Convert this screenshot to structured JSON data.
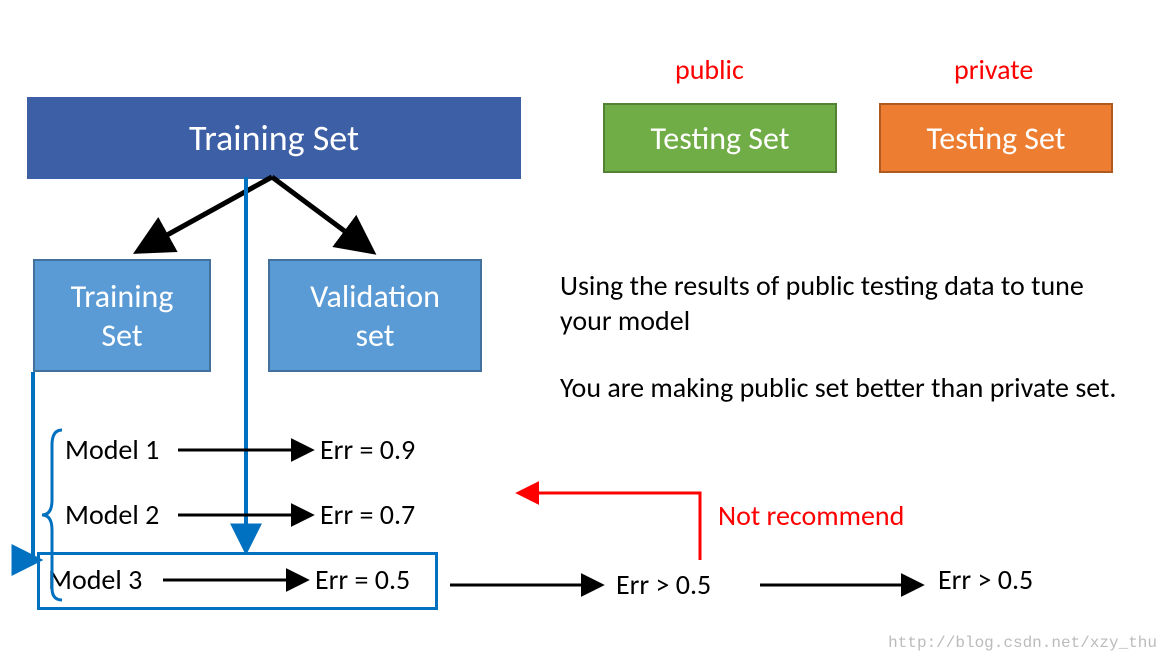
{
  "boxes": {
    "training_set_top": "Training Set",
    "training_set_child": "Training\nSet",
    "validation_set": "Validation\nset",
    "testing_public": "Testing Set",
    "testing_private": "Testing Set"
  },
  "labels": {
    "public": "public",
    "private": "private",
    "model1": "Model 1",
    "model2": "Model 2",
    "model3": "Model 3",
    "err1": "Err = 0.9",
    "err2": "Err = 0.7",
    "err3": "Err = 0.5",
    "err_pub": "Err > 0.5",
    "err_priv": "Err > 0.5",
    "not_recommend": "Not recommend",
    "side1": "Using the results of public testing data to tune your model",
    "side2": "You are making public set better than private set."
  },
  "watermark": "http://blog.csdn.net/xzy_thu",
  "colors": {
    "blue_main": "#3c5fa5",
    "blue_light": "#5b9bd5",
    "green": "#70ad47",
    "orange": "#ed7d31",
    "red": "#ff0000",
    "accent_blue": "#0070c0"
  }
}
